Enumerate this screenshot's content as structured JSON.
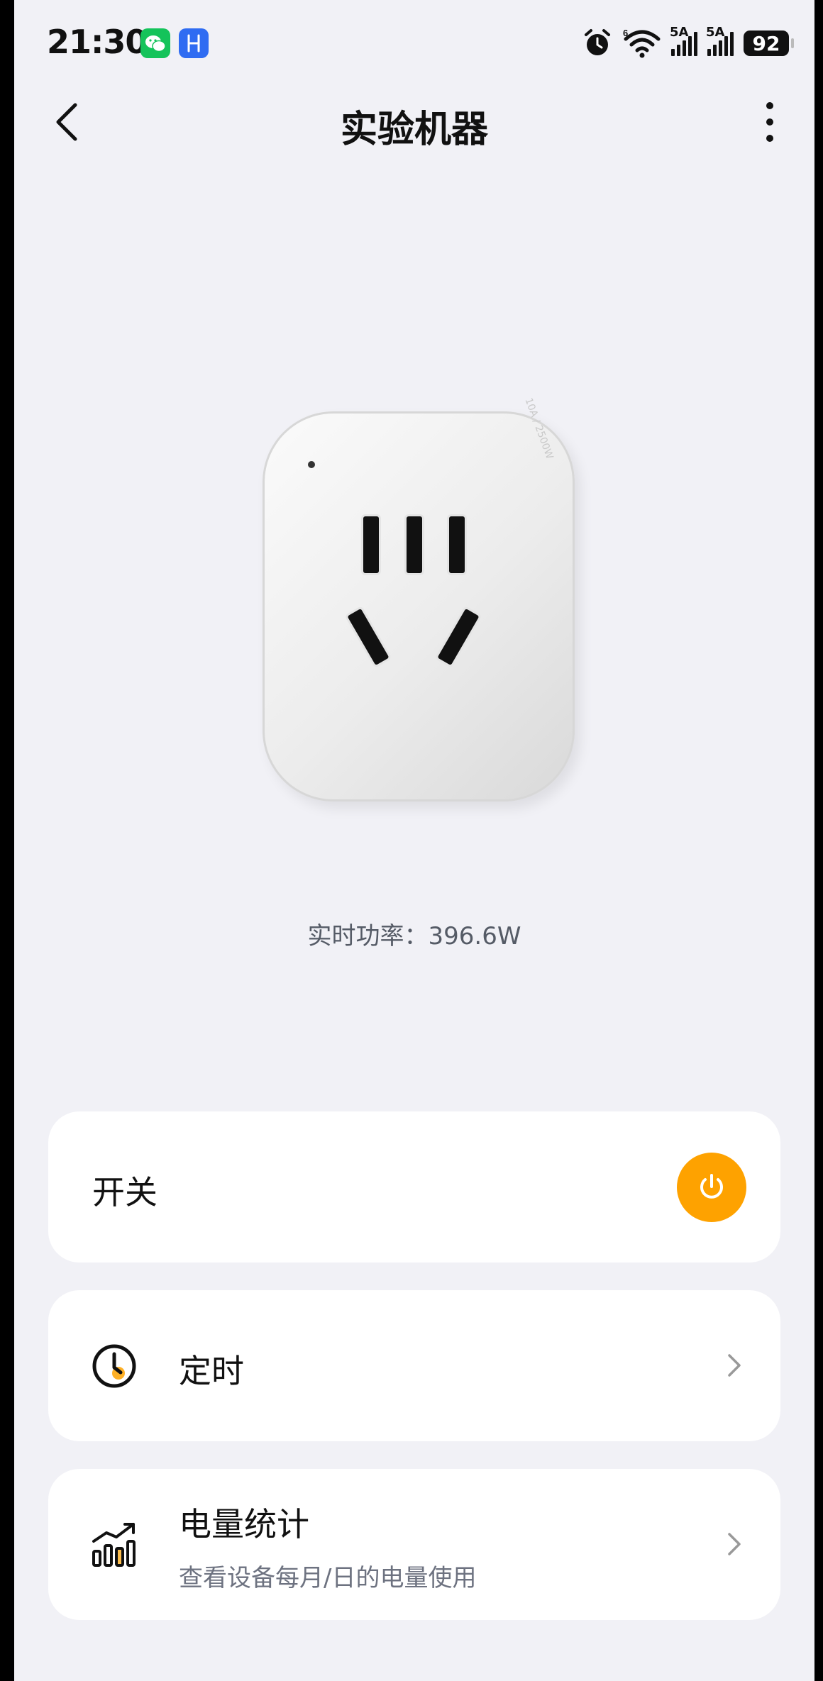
{
  "status_bar": {
    "time": "21:30",
    "signal_1_label": "5A",
    "signal_2_label": "5A",
    "wifi_label": "6",
    "battery": "92",
    "icons": [
      "wechat-icon",
      "app-h-icon",
      "alarm-icon",
      "wifi-icon",
      "signal-icon",
      "signal-icon",
      "battery-icon"
    ]
  },
  "header": {
    "title": "实验机器"
  },
  "device": {
    "rating": "10A / 2500W",
    "power_readout": "实时功率：396.6W"
  },
  "cards": {
    "switch": {
      "label": "开关",
      "accent": "#fea200"
    },
    "timer": {
      "label": "定时"
    },
    "energy": {
      "label": "电量统计",
      "subtitle": "查看设备每月/日的电量使用"
    }
  }
}
